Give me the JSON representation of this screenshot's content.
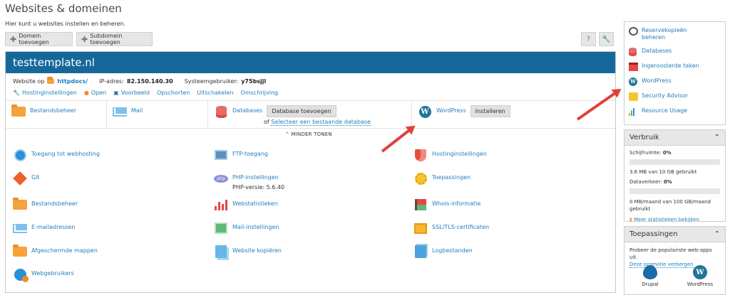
{
  "page": {
    "title": "Websites & domeinen",
    "subtitle": "Hier kunt u websites instellen en beheren."
  },
  "toolbar": {
    "add_domain": "Domein toevoegen",
    "add_subdomain": "Subdomein toevoegen",
    "help_icon": "?",
    "tools_icon": "wrench"
  },
  "domain": {
    "name": "testtemplate.nl",
    "website_label": "Website op",
    "docroot": "httpdocs/",
    "ip_label": "IP-adres:",
    "ip": "82.150.140.30",
    "sysuser_label": "Systeemgebruiker:",
    "sysuser": "y75bsjjl",
    "actions": [
      "Hostinginstellingen",
      "Open",
      "Voorbeeld",
      "Opschorten",
      "Uitschakelen",
      "Omschrijving"
    ]
  },
  "tiles": {
    "file_manager": "Bestandsbeheer",
    "mail": "Mail",
    "databases": "Databases",
    "add_database": "Database toevoegen",
    "select_db_prefix": "of",
    "select_db_link": "Selecteer een bestaande database",
    "wordpress": "WordPress",
    "install": "Installeren",
    "less": "MINDER TONEN"
  },
  "features": {
    "webhosting_access": "Toegang tot webhosting",
    "ftp": "FTP-toegang",
    "hosting_settings": "Hostinginstellingen",
    "git": "Git",
    "php_settings": "PHP-instellingen",
    "php_version": "PHP-versie: 5.6.40",
    "applications": "Toepassingen",
    "file_manager": "Bestandsbeheer",
    "web_stats": "Webstatistieken",
    "whois": "Whois-informatie",
    "email": "E-mailadressen",
    "mail_settings": "Mail-instellingen",
    "ssl": "SSL/TLS-certificaten",
    "protected_dirs": "Afgeschermde mappen",
    "copy_site": "Website kopiëren",
    "logs": "Logbestanden",
    "web_users": "Webgebruikers"
  },
  "sidebar": {
    "links": [
      {
        "label": "Reservekopieën beheren",
        "icon": "backup-icon"
      },
      {
        "label": "Databases",
        "icon": "database-icon"
      },
      {
        "label": "Ingeroosterde taken",
        "icon": "calendar-icon"
      },
      {
        "label": "WordPress",
        "icon": "wordpress-icon"
      },
      {
        "label": "Security Advisor",
        "icon": "lock-icon"
      },
      {
        "label": "Resource Usage",
        "icon": "chart-icon"
      }
    ],
    "usage": {
      "title": "Verbruik",
      "disk_label": "Schijfruimte:",
      "disk_pct": "0%",
      "disk_detail": "3.6 MB van 10 GB gebruikt",
      "traffic_label": "Dataverkeer:",
      "traffic_pct": "0%",
      "traffic_detail": "0 MB/maand van 100 GB/maand gebruikt",
      "more_stats": "Meer statistieken bekijken"
    },
    "apps": {
      "title": "Toepassingen",
      "promo": "Probeer de populairste web-apps uit.",
      "hide_promo": "Deze promotie verbergen",
      "items": [
        "Drupal",
        "WordPress"
      ]
    }
  },
  "colors": {
    "header_blue": "#17689a",
    "link_blue": "#1f7fbf",
    "annotation_red": "#e0413b"
  }
}
